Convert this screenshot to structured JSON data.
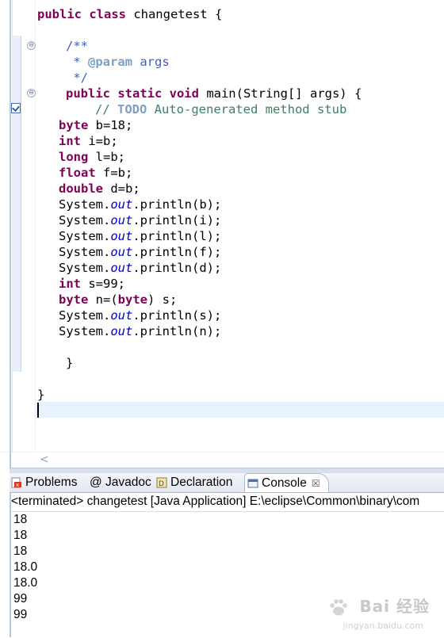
{
  "editor": {
    "lines": [
      {
        "parts": [
          {
            "t": "public class",
            "c": "kw"
          },
          {
            "t": " changetest {",
            "c": ""
          }
        ]
      },
      {
        "parts": [
          {
            "t": "/**",
            "c": "cm"
          }
        ]
      },
      {
        "parts": [
          {
            "t": " * ",
            "c": "cm"
          },
          {
            "t": "@param",
            "c": "tag"
          },
          {
            "t": " args",
            "c": "cm"
          }
        ]
      },
      {
        "parts": [
          {
            "t": " */",
            "c": "cm"
          }
        ]
      },
      {
        "parts": [
          {
            "t": "public static void",
            "c": "kw"
          },
          {
            "t": " main(String[] args) {",
            "c": ""
          }
        ]
      },
      {
        "parts": [
          {
            "t": "// ",
            "c": "cl"
          },
          {
            "t": "TODO",
            "c": "todo"
          },
          {
            "t": " Auto-generated method stub",
            "c": "cl"
          }
        ]
      },
      {
        "parts": [
          {
            "t": "byte",
            "c": "kw"
          },
          {
            "t": " b=18;",
            "c": ""
          }
        ]
      },
      {
        "parts": [
          {
            "t": "int",
            "c": "kw"
          },
          {
            "t": " i=b;",
            "c": ""
          }
        ]
      },
      {
        "parts": [
          {
            "t": "long",
            "c": "kw"
          },
          {
            "t": " l=b;",
            "c": ""
          }
        ]
      },
      {
        "parts": [
          {
            "t": "float",
            "c": "kw"
          },
          {
            "t": " f=b;",
            "c": ""
          }
        ]
      },
      {
        "parts": [
          {
            "t": "double",
            "c": "kw"
          },
          {
            "t": " d=b;",
            "c": ""
          }
        ]
      },
      {
        "parts": [
          {
            "t": "System.",
            "c": ""
          },
          {
            "t": "out",
            "c": "fld"
          },
          {
            "t": ".println(b);",
            "c": ""
          }
        ]
      },
      {
        "parts": [
          {
            "t": "System.",
            "c": ""
          },
          {
            "t": "out",
            "c": "fld"
          },
          {
            "t": ".println(i);",
            "c": ""
          }
        ]
      },
      {
        "parts": [
          {
            "t": "System.",
            "c": ""
          },
          {
            "t": "out",
            "c": "fld"
          },
          {
            "t": ".println(l);",
            "c": ""
          }
        ]
      },
      {
        "parts": [
          {
            "t": "System.",
            "c": ""
          },
          {
            "t": "out",
            "c": "fld"
          },
          {
            "t": ".println(f);",
            "c": ""
          }
        ]
      },
      {
        "parts": [
          {
            "t": "System.",
            "c": ""
          },
          {
            "t": "out",
            "c": "fld"
          },
          {
            "t": ".println(d);",
            "c": ""
          }
        ]
      },
      {
        "parts": [
          {
            "t": "int",
            "c": "kw"
          },
          {
            "t": " s=99;",
            "c": ""
          }
        ]
      },
      {
        "parts": [
          {
            "t": "byte",
            "c": "kw"
          },
          {
            "t": " n=(",
            "c": ""
          },
          {
            "t": "byte",
            "c": "kw"
          },
          {
            "t": ") s;",
            "c": ""
          }
        ]
      },
      {
        "parts": [
          {
            "t": "System.",
            "c": ""
          },
          {
            "t": "out",
            "c": "fld"
          },
          {
            "t": ".println(s);",
            "c": ""
          }
        ]
      },
      {
        "parts": [
          {
            "t": "System.",
            "c": ""
          },
          {
            "t": "out",
            "c": "fld"
          },
          {
            "t": ".println(n);",
            "c": ""
          }
        ]
      },
      {
        "parts": [
          {
            "t": "}",
            "c": ""
          }
        ]
      },
      {
        "parts": [
          {
            "t": "}",
            "c": ""
          }
        ]
      }
    ],
    "fold_glyph": "⊖",
    "scroll_left_arrow": "<"
  },
  "tabs": [
    {
      "label": "Problems",
      "icon": "problems-icon"
    },
    {
      "label": "@ Javadoc",
      "icon": "javadoc-icon"
    },
    {
      "label": "Declaration",
      "icon": "declaration-icon"
    },
    {
      "label": "Console",
      "icon": "console-icon",
      "close": "☒"
    }
  ],
  "console": {
    "header": "<terminated> changetest [Java Application] E:\\eclipse\\Common\\binary\\com",
    "output": [
      "18",
      "18",
      "18",
      "18.0",
      "18.0",
      "99",
      "99"
    ]
  },
  "watermark": {
    "text": "Bai  经验",
    "url": "jingyan.baidu.com"
  },
  "colors": {
    "keyword": "#7f0055",
    "comment": "#3f5fbf",
    "line_comment": "#3f7f5f",
    "field": "#0000c0"
  }
}
